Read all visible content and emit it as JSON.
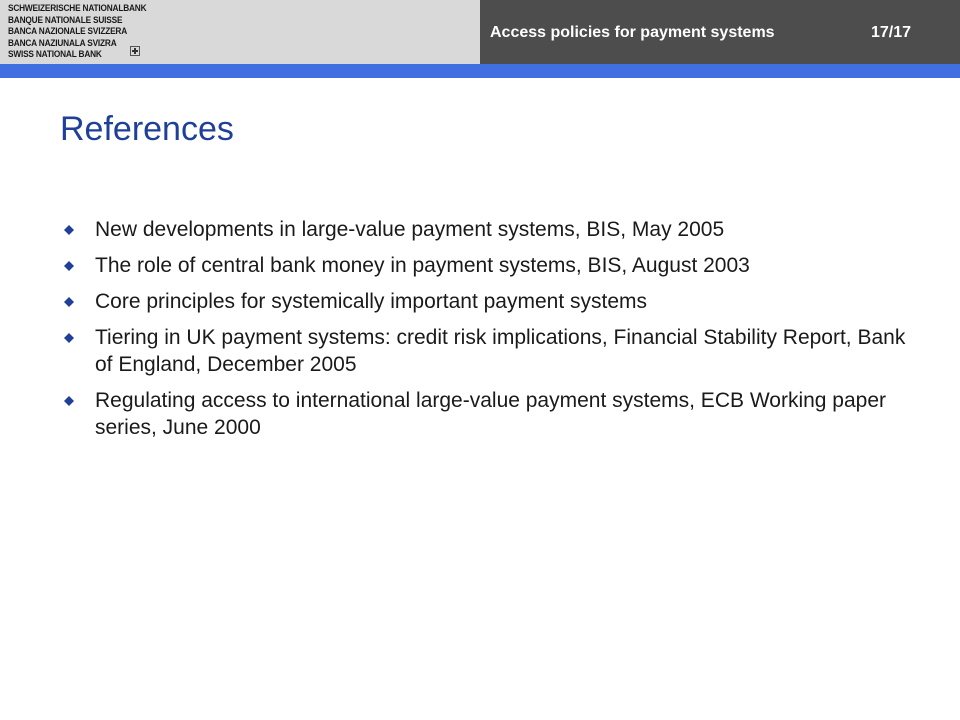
{
  "header": {
    "logo_lines": [
      "SCHWEIZERISCHE NATIONALBANK",
      "BANQUE NATIONALE SUISSE",
      "BANCA NAZIONALE SVIZZERA",
      "BANCA NAZIUNALA SVIZRA",
      "SWISS NATIONAL BANK"
    ],
    "presentation_title": "Access policies for payment systems",
    "page_indicator": "17/17"
  },
  "colors": {
    "header_left_bg": "#d9d9d9",
    "header_right_bg": "#4d4d4d",
    "accent_bar": "#3f6fe0",
    "title": "#1f3f9a",
    "bullet": "#1f3f9a",
    "body_text": "#1a1a1a"
  },
  "slide": {
    "title": "References",
    "bullet_icon": "diamond-bullet-icon",
    "items": [
      "New developments in large-value payment systems, BIS, May 2005",
      "The role of central bank money in payment systems, BIS, August 2003",
      "Core principles for systemically important payment systems",
      "Tiering in UK payment systems: credit risk implications, Financial Stability Report, Bank of England, December 2005",
      "Regulating access to international large-value payment systems, ECB Working paper series, June 2000"
    ]
  }
}
